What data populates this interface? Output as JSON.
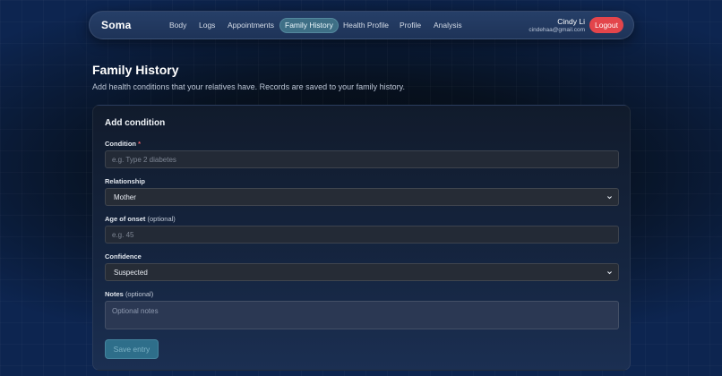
{
  "nav": {
    "brand": "Soma",
    "links": [
      {
        "label": "Body",
        "active": false
      },
      {
        "label": "Logs",
        "active": false
      },
      {
        "label": "Appointments",
        "active": false
      },
      {
        "label": "Family History",
        "active": true
      },
      {
        "label": "Health Profile",
        "active": false
      },
      {
        "label": "Profile",
        "active": false
      },
      {
        "label": "Analysis",
        "active": false
      }
    ],
    "theme_icon": "sun-icon",
    "user_name": "Cindy Li",
    "user_email": "cindehaa@gmail.com",
    "logout_label": "Logout"
  },
  "page": {
    "title": "Family History",
    "subtitle": "Add health conditions that your relatives have. Records are saved to your family history."
  },
  "form": {
    "title": "Add condition",
    "condition": {
      "label": "Condition",
      "required_mark": "*",
      "value": "",
      "placeholder": "e.g. Type 2 diabetes"
    },
    "relationship": {
      "label": "Relationship",
      "value": "Mother"
    },
    "age_of_onset": {
      "label": "Age of onset",
      "optional": "(optional)",
      "value": "",
      "placeholder": "e.g. 45"
    },
    "confidence": {
      "label": "Confidence",
      "value": "Suspected"
    },
    "notes": {
      "label": "Notes",
      "optional": "(optional)",
      "value": "",
      "placeholder": "Optional notes"
    },
    "save_label": "Save entry"
  },
  "colors": {
    "accent_active_tab": "#3e6f86",
    "logout": "#e3454b",
    "save_button": "#2e6e8a",
    "required_mark": "#f0616a"
  }
}
